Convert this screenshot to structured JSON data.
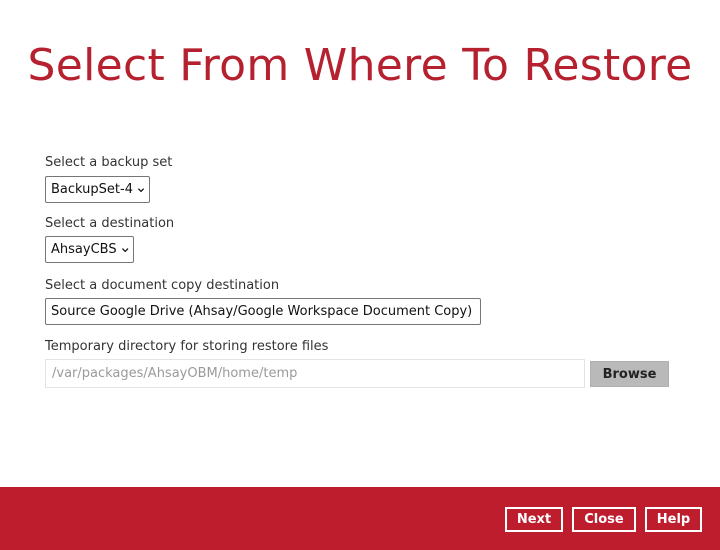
{
  "page": {
    "title": "Select From Where To Restore"
  },
  "backup_set": {
    "label": "Select a backup set",
    "value": "BackupSet-4"
  },
  "destination": {
    "label": "Select a destination",
    "value": "AhsayCBS"
  },
  "document_copy_destination": {
    "label": "Select a document copy destination",
    "value": "Source Google Drive (Ahsay/Google Workspace Document Copy)"
  },
  "temp_directory": {
    "label": "Temporary directory for storing restore files",
    "value": "/var/packages/AhsayOBM/home/temp",
    "browse_label": "Browse"
  },
  "footer": {
    "next_label": "Next",
    "close_label": "Close",
    "help_label": "Help"
  },
  "colors": {
    "brand_red": "#be1d2d",
    "title_red": "#b5212f",
    "browse_gray": "#b9b9b9"
  },
  "icons": {
    "select_arrow": "chevron-down-icon"
  }
}
